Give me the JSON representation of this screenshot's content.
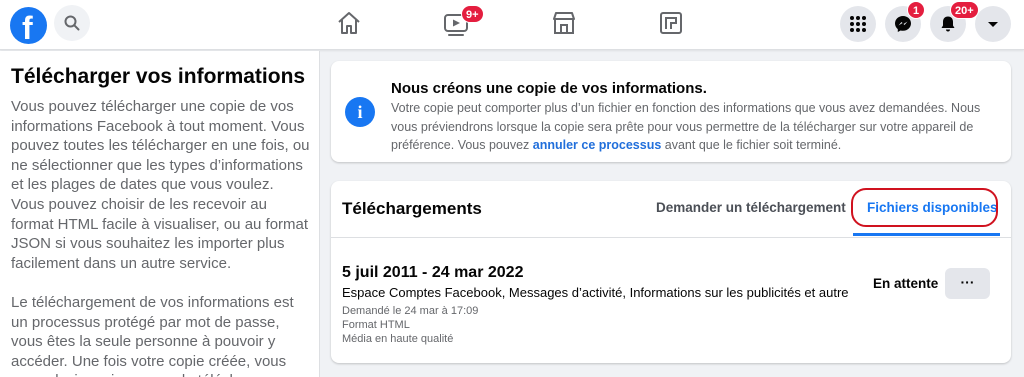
{
  "topbar": {
    "logo_letter": "f",
    "badges": {
      "watch": "9+",
      "messenger": "1",
      "notifications": "20+"
    }
  },
  "left_panel": {
    "title": "Télécharger vos informations",
    "paragraph1": "Vous pouvez télécharger une copie de vos informations Facebook à tout moment. Vous pouvez toutes les télécharger en une fois, ou ne sélectionner que les types d’informations et les plages de dates que vous voulez. Vous pouvez choisir de les recevoir au format HTML facile à visualiser, ou au format JSON si vous souhaitez les importer plus facilement dans un autre service.",
    "paragraph2": "Le téléchargement de vos informations est un processus protégé par mot de passe, vous êtes la seule personne à pouvoir y accéder. Une fois votre copie créée, vous avez plusieurs jours pour la télécharger."
  },
  "info_card": {
    "icon_glyph": "i",
    "title": "Nous créons une copie de vos informations.",
    "text_before_link": "Votre copie peut comporter plus d’un fichier en fonction des informations que vous avez demandées. Nous vous préviendrons lorsque la copie sera prête pour vous permettre de la télécharger sur votre appareil de préférence. Vous pouvez ",
    "link_text": "annuler ce processus",
    "text_after_link": " avant que le fichier soit terminé."
  },
  "downloads": {
    "title": "Téléchargements",
    "tabs": {
      "request": "Demander un téléchargement",
      "files": "Fichiers disponibles"
    },
    "item": {
      "date_range": "5 juil 2011 - 24 mar 2022",
      "categories": "Espace Comptes Facebook, Messages d’activité, Informations sur les publicités et autre",
      "requested": "Demandé le 24 mar à 17:09",
      "format": "Format HTML",
      "quality": "Média en haute qualité",
      "status": "En attente",
      "more_label": "···"
    }
  },
  "colors": {
    "brand_blue": "#1877f2",
    "badge_red": "#e41e3f",
    "annotation_ring": "#d0121f"
  },
  "icons": [
    "facebook-logo",
    "search-icon",
    "home-icon",
    "watch-icon",
    "marketplace-icon",
    "gaming-icon",
    "menu-grid-icon",
    "messenger-icon",
    "notifications-bell-icon",
    "account-chevron-icon",
    "info-icon",
    "more-dots-icon"
  ]
}
